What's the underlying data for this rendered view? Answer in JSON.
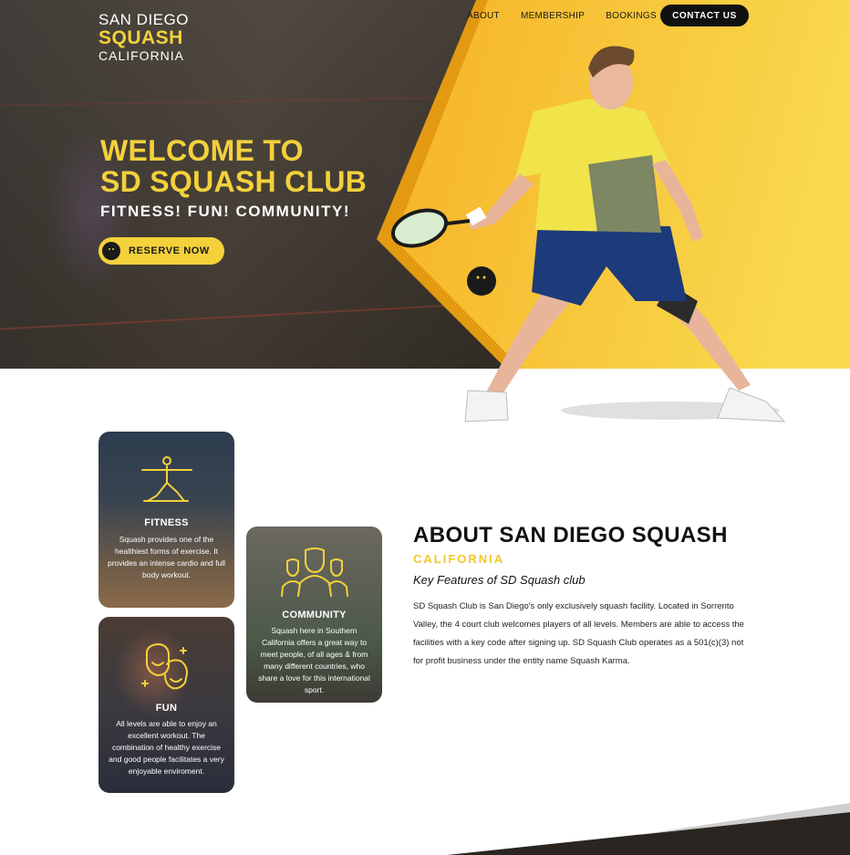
{
  "logo": {
    "line1": "SAN DIEGO",
    "line2": "SQUASH",
    "line3": "CALIFORNIA"
  },
  "nav": {
    "items": [
      {
        "label": "ABOUT"
      },
      {
        "label": "MEMBERSHIP"
      },
      {
        "label": "BOOKINGS"
      }
    ],
    "contact_label": "CONTACT US"
  },
  "hero": {
    "title_line1": "WELCOME TO",
    "title_line2": "SD SQUASH CLUB",
    "subtitle": "FITNESS! FUN! COMMUNITY!",
    "reserve_label": "RESERVE NOW"
  },
  "features": {
    "fitness": {
      "title": "FITNESS",
      "icon": "yoga-pose-icon",
      "text": "Squash provides one of the healthiest forms of exercise. It provides an intense cardio and full body workout."
    },
    "community": {
      "title": "COMMUNITY",
      "icon": "group-people-icon",
      "text": "Squash here in Southern California offers a great way to meet people, of all ages & from many different countries, who share a love for this international sport."
    },
    "fun": {
      "title": "FUN",
      "icon": "happy-faces-icon",
      "text": "All levels are able to enjoy an excellent workout. The combination of healthy exercise and good people facilitates a very enjoyable enviroment."
    }
  },
  "about": {
    "title": "ABOUT SAN DIEGO SQUASH",
    "subtitle": "CALIFORNIA",
    "features_heading": "Key Features of SD Squash club",
    "body": "SD Squash Club is San Diego's only exclusively squash facility. Located in Sorrento Valley, the 4 court club welcomes players of all levels. Members are able to access the facilities with a key code after signing up. SD Squash Club operates as a 501(c)(3) not for profit business under the entity name Squash Karma."
  },
  "colors": {
    "accent": "#f4d13b",
    "dark": "#111111",
    "hero_bg": "#3b352d"
  }
}
